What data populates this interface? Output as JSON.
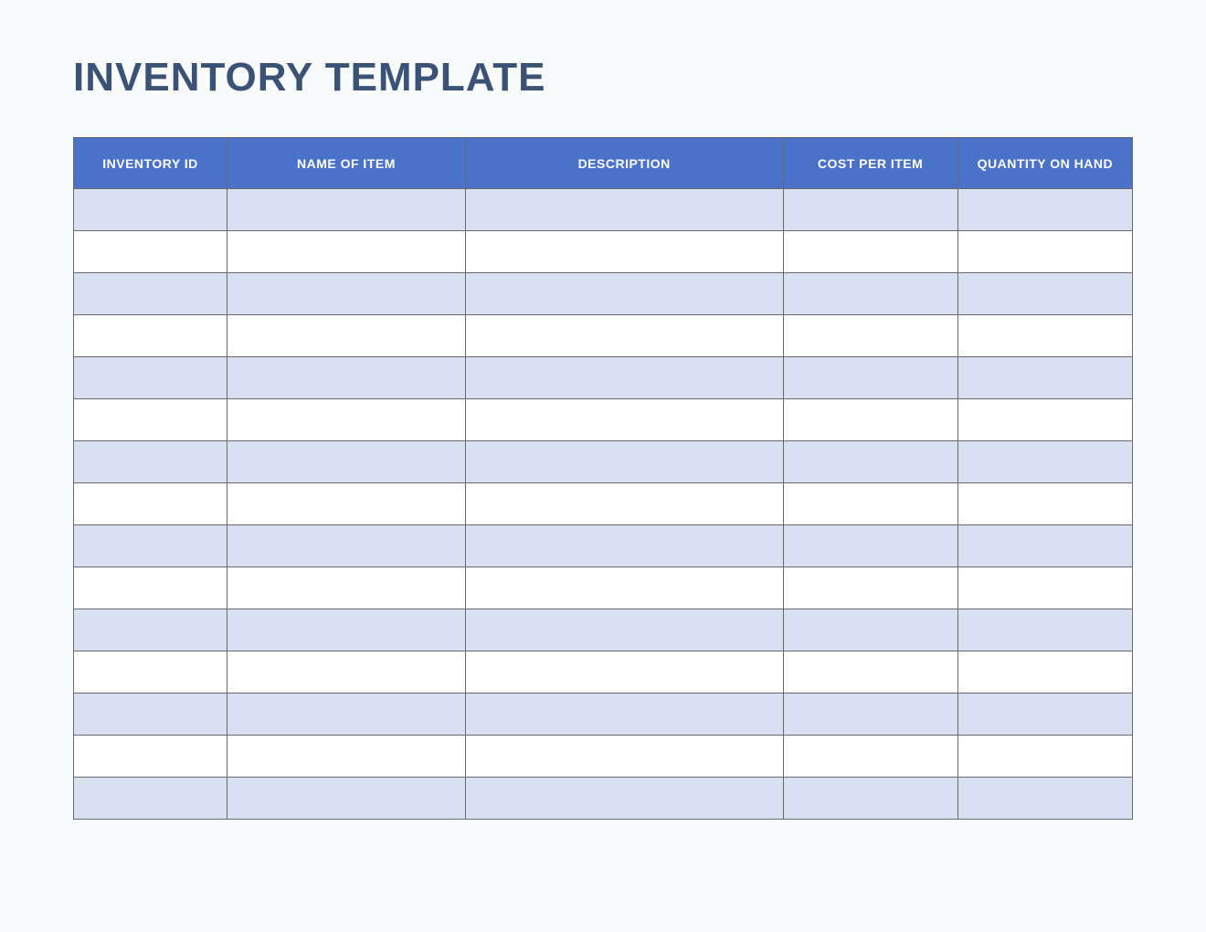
{
  "title": "INVENTORY TEMPLATE",
  "columns": [
    "INVENTORY ID",
    "NAME OF ITEM",
    "DESCRIPTION",
    "COST PER ITEM",
    "QUANTITY ON HAND"
  ],
  "rows": [
    {
      "inventory_id": "",
      "name": "",
      "description": "",
      "cost_per_item": "",
      "quantity_on_hand": ""
    },
    {
      "inventory_id": "",
      "name": "",
      "description": "",
      "cost_per_item": "",
      "quantity_on_hand": ""
    },
    {
      "inventory_id": "",
      "name": "",
      "description": "",
      "cost_per_item": "",
      "quantity_on_hand": ""
    },
    {
      "inventory_id": "",
      "name": "",
      "description": "",
      "cost_per_item": "",
      "quantity_on_hand": ""
    },
    {
      "inventory_id": "",
      "name": "",
      "description": "",
      "cost_per_item": "",
      "quantity_on_hand": ""
    },
    {
      "inventory_id": "",
      "name": "",
      "description": "",
      "cost_per_item": "",
      "quantity_on_hand": ""
    },
    {
      "inventory_id": "",
      "name": "",
      "description": "",
      "cost_per_item": "",
      "quantity_on_hand": ""
    },
    {
      "inventory_id": "",
      "name": "",
      "description": "",
      "cost_per_item": "",
      "quantity_on_hand": ""
    },
    {
      "inventory_id": "",
      "name": "",
      "description": "",
      "cost_per_item": "",
      "quantity_on_hand": ""
    },
    {
      "inventory_id": "",
      "name": "",
      "description": "",
      "cost_per_item": "",
      "quantity_on_hand": ""
    },
    {
      "inventory_id": "",
      "name": "",
      "description": "",
      "cost_per_item": "",
      "quantity_on_hand": ""
    },
    {
      "inventory_id": "",
      "name": "",
      "description": "",
      "cost_per_item": "",
      "quantity_on_hand": ""
    },
    {
      "inventory_id": "",
      "name": "",
      "description": "",
      "cost_per_item": "",
      "quantity_on_hand": ""
    },
    {
      "inventory_id": "",
      "name": "",
      "description": "",
      "cost_per_item": "",
      "quantity_on_hand": ""
    },
    {
      "inventory_id": "",
      "name": "",
      "description": "",
      "cost_per_item": "",
      "quantity_on_hand": ""
    }
  ],
  "colors": {
    "header_bg": "#4a72c8",
    "stripe_bg": "#d9e0f2",
    "title_color": "#3a5275",
    "border": "#6a6a6a"
  }
}
